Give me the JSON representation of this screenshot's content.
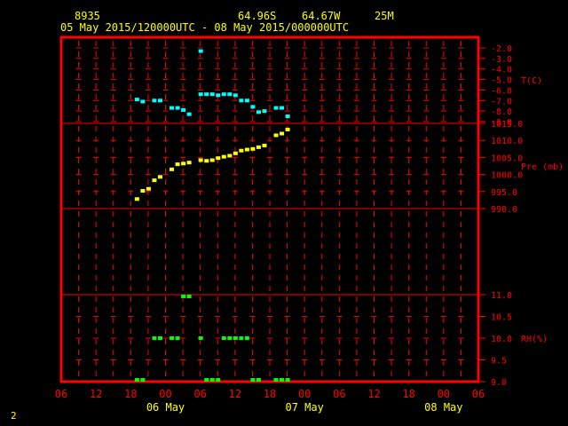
{
  "header": {
    "station": "8935",
    "lat": "64.96S",
    "lon": "64.67W",
    "elev": "25M",
    "period": "05 May 2015/120000UTC - 08 May 2015/000000UTC"
  },
  "footer": {
    "page": "2"
  },
  "colors": {
    "frame": "#ff0000",
    "text": "#ffff00",
    "temp": "#00ffff",
    "pressure": "#ffff00",
    "rh": "#00ff00"
  },
  "chart_data": [
    {
      "type": "scatter",
      "ylabel": "T(C)",
      "ylim": [
        -9.0,
        -2.0
      ],
      "yticks": [
        "-2.0",
        "-3.0",
        "-4.0",
        "-5.0",
        "-6.0",
        "-7.0",
        "-8.0",
        "-9.0"
      ],
      "ytick_values": [
        -2,
        -3,
        -4,
        -5,
        -6,
        -7,
        -8,
        -9
      ],
      "color": "#00ffff",
      "x": [
        19,
        20,
        21,
        22,
        23,
        26,
        27,
        28,
        29,
        30,
        31,
        34,
        35,
        36,
        37,
        38,
        39,
        40,
        41,
        42,
        43,
        44,
        45,
        46,
        47,
        48,
        49,
        50,
        51
      ],
      "y": [
        -6.9,
        -7.1,
        -7.0,
        -7.0,
        -7.8,
        -7.7,
        -7.8,
        -7.9,
        -8.3,
        -2.3,
        -6.4,
        -6.4,
        -6.4,
        -6.5,
        -6.4,
        -6.4,
        -6.5,
        -7.0,
        -7.0,
        -7.7,
        -8.1,
        -8.0,
        -7.7,
        -7.7,
        -8.4,
        -7.7,
        -8.5
      ],
      "x_hours": [
        19,
        20,
        21,
        22,
        23,
        24,
        25,
        26,
        27,
        28,
        30,
        31,
        32,
        33,
        34,
        35,
        36,
        37,
        38,
        39,
        40,
        41,
        42,
        43,
        44,
        45,
        46,
        47,
        48
      ],
      "points": [
        [
          19,
          -6.9
        ],
        [
          20,
          -7.1
        ],
        [
          22,
          -7.0
        ],
        [
          23,
          -7.0
        ],
        [
          25,
          -7.7
        ],
        [
          26,
          -7.7
        ],
        [
          27,
          -7.9
        ],
        [
          28,
          -8.3
        ],
        [
          30,
          -2.3
        ],
        [
          30,
          -6.4
        ],
        [
          31,
          -6.4
        ],
        [
          32,
          -6.4
        ],
        [
          33,
          -6.5
        ],
        [
          34,
          -6.4
        ],
        [
          35,
          -6.4
        ],
        [
          36,
          -6.5
        ],
        [
          37,
          -7.0
        ],
        [
          38,
          -7.0
        ],
        [
          39,
          -7.6
        ],
        [
          40,
          -8.1
        ],
        [
          41,
          -8.0
        ],
        [
          43,
          -7.7
        ],
        [
          44,
          -7.7
        ],
        [
          45,
          -8.5
        ]
      ]
    },
    {
      "type": "scatter",
      "ylabel": "Pre (mb)",
      "ylim": [
        990.0,
        1015.0
      ],
      "yticks": [
        "1015.0",
        "1010.0",
        "1005.0",
        "1000.0",
        "995.0",
        "990.0"
      ],
      "ytick_values": [
        1015,
        1010,
        1005,
        1000,
        995,
        990
      ],
      "color": "#ffff00",
      "points": [
        [
          19,
          992.8
        ],
        [
          20,
          995.2
        ],
        [
          21,
          995.8
        ],
        [
          22,
          998.3
        ],
        [
          23,
          999.3
        ],
        [
          25,
          1001.5
        ],
        [
          26,
          1003.0
        ],
        [
          27,
          1003.2
        ],
        [
          28,
          1003.5
        ],
        [
          30,
          1004.2
        ],
        [
          31,
          1004.0
        ],
        [
          32,
          1004.2
        ],
        [
          33,
          1004.8
        ],
        [
          34,
          1005.2
        ],
        [
          35,
          1005.5
        ],
        [
          36,
          1006.2
        ],
        [
          37,
          1007.0
        ],
        [
          38,
          1007.3
        ],
        [
          39,
          1007.5
        ],
        [
          40,
          1008.0
        ],
        [
          41,
          1008.5
        ],
        [
          43,
          1011.5
        ],
        [
          44,
          1012.0
        ],
        [
          45,
          1013.2
        ]
      ]
    },
    {
      "type": "scatter",
      "ylabel": "RH(%)",
      "ylim": [
        9.0,
        11.0
      ],
      "yticks": [
        "11.0",
        "10.5",
        "10.0",
        "9.5",
        "9.0"
      ],
      "ytick_values": [
        11,
        10.5,
        10,
        9.5,
        9
      ],
      "color": "#00ff00",
      "points": [
        [
          19,
          9.0
        ],
        [
          20,
          9.0
        ],
        [
          22,
          10.0
        ],
        [
          23,
          10.0
        ],
        [
          25,
          10.0
        ],
        [
          26,
          10.0
        ],
        [
          27,
          11.0
        ],
        [
          28,
          11.0
        ],
        [
          30,
          10.0
        ],
        [
          31,
          9.0
        ],
        [
          32,
          9.0
        ],
        [
          33,
          9.0
        ],
        [
          34,
          10.0
        ],
        [
          35,
          10.0
        ],
        [
          36,
          10.0
        ],
        [
          37,
          10.0
        ],
        [
          38,
          10.0
        ],
        [
          39,
          9.0
        ],
        [
          40,
          9.0
        ],
        [
          43,
          9.0
        ],
        [
          44,
          9.0
        ],
        [
          45,
          9.0
        ]
      ]
    }
  ],
  "x_axis": {
    "hour_ticks": [
      "06",
      "12",
      "18",
      "00",
      "06",
      "12",
      "18",
      "00",
      "06",
      "12",
      "18",
      "00",
      "06"
    ],
    "hour_values": [
      6,
      12,
      18,
      24,
      30,
      36,
      42,
      48,
      54,
      60,
      66,
      72,
      78
    ],
    "day_labels": [
      {
        "text": "06 May",
        "hour": 24
      },
      {
        "text": "07 May",
        "hour": 48
      },
      {
        "text": "08 May",
        "hour": 72
      }
    ],
    "xlim": [
      6,
      78
    ]
  }
}
